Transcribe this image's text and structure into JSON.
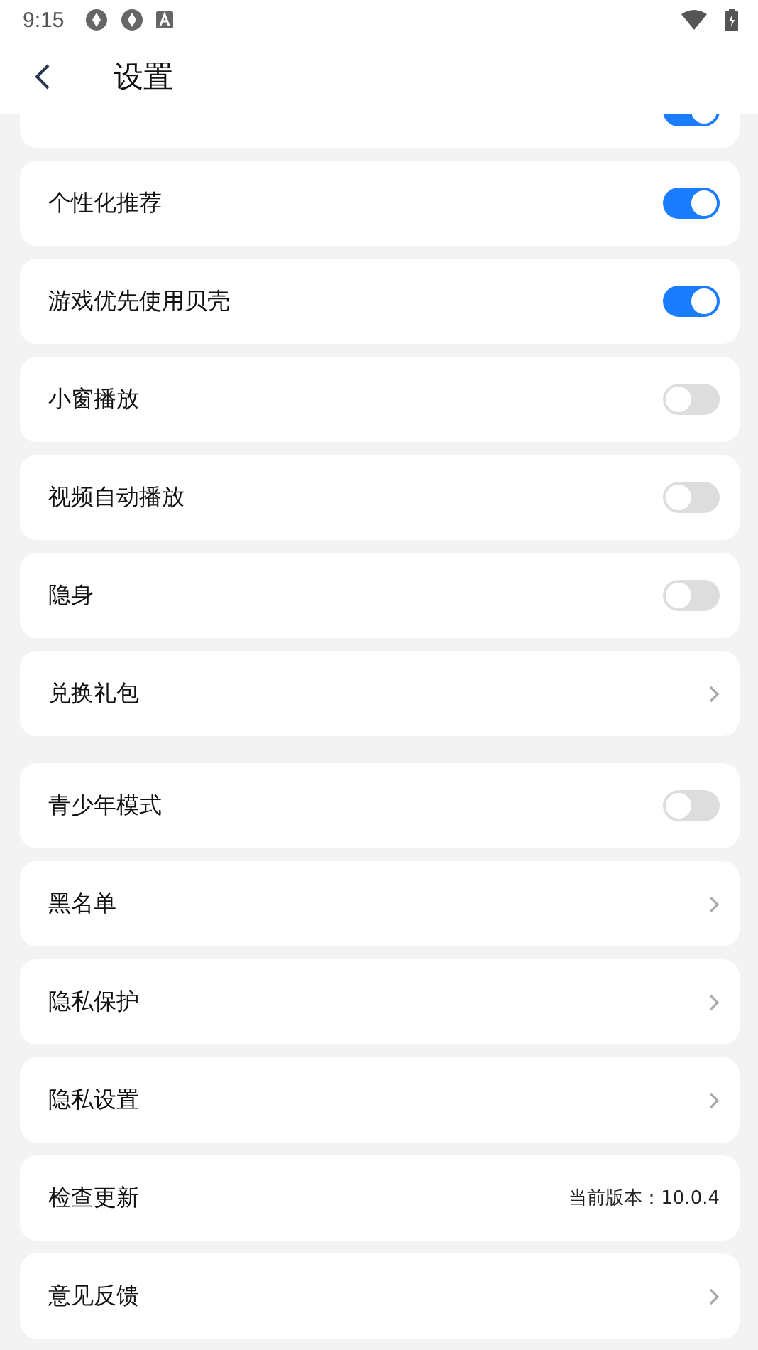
{
  "status_bar": {
    "time": "9:15"
  },
  "header": {
    "title": "设置"
  },
  "partial_item": {
    "kind": "toggle",
    "on": true
  },
  "groups": [
    {
      "items": [
        {
          "kind": "toggle",
          "label": "个性化推荐",
          "on": true
        },
        {
          "kind": "toggle",
          "label": "游戏优先使用贝壳",
          "on": true
        },
        {
          "kind": "toggle",
          "label": "小窗播放",
          "on": false
        },
        {
          "kind": "toggle",
          "label": "视频自动播放",
          "on": false
        },
        {
          "kind": "toggle",
          "label": "隐身",
          "on": false
        },
        {
          "kind": "link",
          "label": "兑换礼包"
        }
      ]
    },
    {
      "items": [
        {
          "kind": "toggle",
          "label": "青少年模式",
          "on": false
        },
        {
          "kind": "link",
          "label": "黑名单"
        },
        {
          "kind": "link",
          "label": "隐私保护"
        },
        {
          "kind": "link",
          "label": "隐私设置"
        },
        {
          "kind": "value",
          "label": "检查更新",
          "value": "当前版本：10.0.4"
        },
        {
          "kind": "link",
          "label": "意见反馈"
        }
      ]
    }
  ]
}
